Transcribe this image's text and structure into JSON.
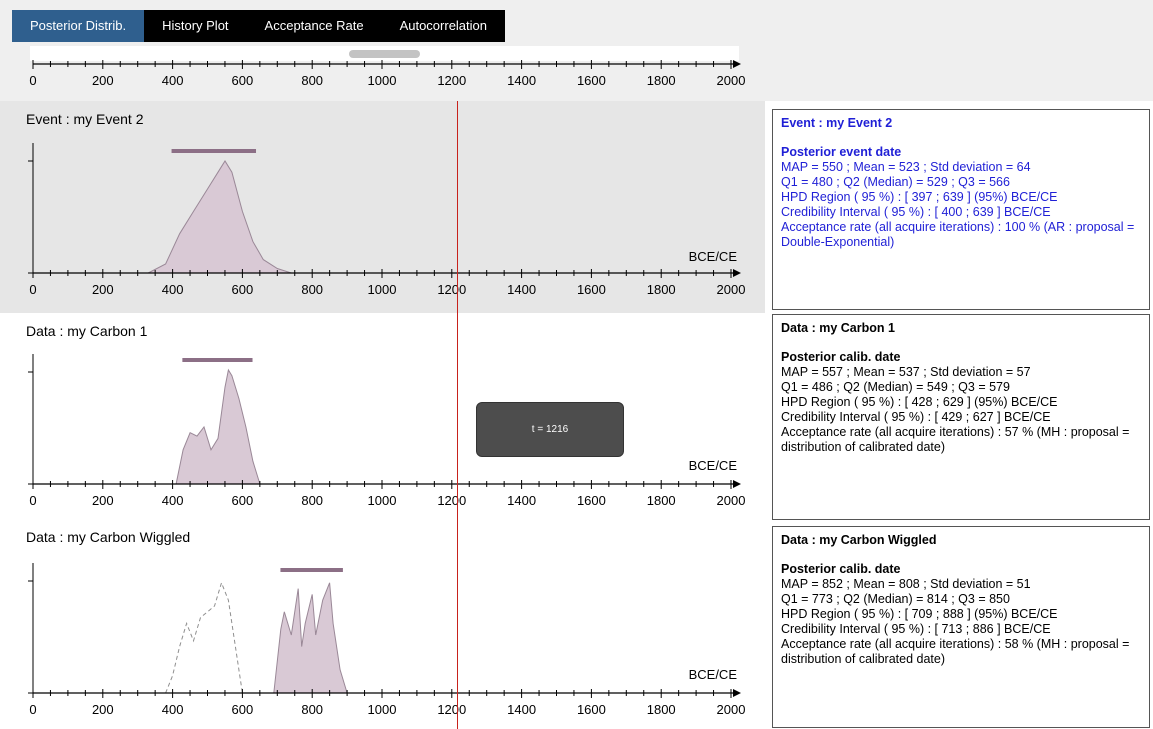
{
  "tabs": [
    {
      "label": "Posterior Distrib.",
      "active": true
    },
    {
      "label": "History Plot",
      "active": false
    },
    {
      "label": "Acceptance Rate",
      "active": false
    },
    {
      "label": "Autocorrelation",
      "active": false
    }
  ],
  "axis": {
    "min": 0,
    "max": 2000,
    "ticks": [
      "0",
      "200",
      "400",
      "600",
      "800",
      "1000",
      "1200",
      "1400",
      "1600",
      "1800",
      "2000"
    ],
    "unit_label": "BCE/CE"
  },
  "scrollbar": {
    "thumb_start": 0.45,
    "thumb_end": 0.55
  },
  "cursor": {
    "value": 1216,
    "tooltip": "t = 1216"
  },
  "panels": [
    {
      "title": "Event : my Event 2",
      "hpd": [
        397,
        639
      ],
      "info": {
        "heading": "Event : my Event 2",
        "subheading": "Posterior event date",
        "lines": [
          "MAP = 550 ; Mean = 523 ; Std deviation = 64",
          "Q1 = 480 ; Q2 (Median) = 529 ; Q3 = 566",
          "HPD Region ( 95 %) : [ 397 ; 639 ] (95%) BCE/CE",
          "Credibility Interval ( 95 %) : [ 400 ; 639 ] BCE/CE",
          "Acceptance rate (all acquire iterations) : 100 % (AR : proposal = Double-Exponential)"
        ]
      }
    },
    {
      "title": "Data : my Carbon 1",
      "hpd": [
        428,
        629
      ],
      "info": {
        "heading": "Data : my Carbon 1",
        "subheading": "Posterior calib. date",
        "lines": [
          "MAP = 557 ; Mean = 537 ; Std deviation = 57",
          "Q1 = 486 ; Q2 (Median) = 549 ; Q3 = 579",
          "HPD Region ( 95 %) : [ 428 ; 629 ] (95%) BCE/CE",
          "Credibility Interval ( 95 %) : [ 429 ; 627 ] BCE/CE",
          "Acceptance rate (all acquire iterations) : 57 % (MH : proposal = distribution of calibrated date)"
        ]
      }
    },
    {
      "title": "Data : my Carbon Wiggled",
      "hpd": [
        709,
        888
      ],
      "info": {
        "heading": "Data : my Carbon Wiggled",
        "subheading": "Posterior calib. date",
        "lines": [
          "MAP = 852 ; Mean = 808 ; Std deviation = 51",
          "Q1 = 773 ; Q2 (Median) = 814 ; Q3 = 850",
          "HPD Region ( 95 %) : [ 709 ; 888 ] (95%) BCE/CE",
          "Credibility Interval ( 95 %) : [ 713 ; 886 ] BCE/CE",
          "Acceptance rate (all acquire iterations) : 58 % (MH : proposal = distribution of calibrated date)"
        ]
      }
    }
  ],
  "colors": {
    "active_tab": "#2f5f8e",
    "hpd_bar": "#8c6f86",
    "density_fill": "#d9c9d5",
    "density_line": "#9a8897",
    "cursor": "#c8221c",
    "event_panel_bg": "#e6e6e6",
    "blue_text": "#1f1fd6"
  },
  "chart_data": [
    {
      "type": "area",
      "title": "Event : my Event 2",
      "xlabel": "BCE/CE",
      "xlim": [
        0,
        2000
      ],
      "series": [
        {
          "x": [
            330,
            380,
            420,
            460,
            500,
            530,
            550,
            570,
            600,
            630,
            660,
            700,
            740
          ],
          "y": [
            0.0,
            0.08,
            0.35,
            0.55,
            0.75,
            0.9,
            1.0,
            0.9,
            0.55,
            0.28,
            0.12,
            0.04,
            0.0
          ]
        }
      ]
    },
    {
      "type": "area",
      "title": "Data : my Carbon 1",
      "xlabel": "BCE/CE",
      "xlim": [
        0,
        2000
      ],
      "series": [
        {
          "x": [
            410,
            430,
            450,
            470,
            490,
            510,
            530,
            550,
            560,
            570,
            590,
            610,
            630,
            650
          ],
          "y": [
            0.0,
            0.3,
            0.45,
            0.42,
            0.5,
            0.3,
            0.4,
            0.85,
            1.0,
            0.95,
            0.75,
            0.5,
            0.2,
            0.0
          ]
        }
      ]
    },
    {
      "type": "area",
      "title": "Data : my Carbon Wiggled",
      "xlabel": "BCE/CE",
      "xlim": [
        0,
        2000
      ],
      "series": [
        {
          "x": [
            690,
            710,
            720,
            740,
            760,
            770,
            780,
            800,
            810,
            830,
            850,
            860,
            880,
            900
          ],
          "y": [
            0.0,
            0.55,
            0.7,
            0.5,
            0.9,
            0.4,
            0.6,
            0.85,
            0.5,
            0.8,
            0.95,
            0.6,
            0.2,
            0.0
          ]
        }
      ],
      "prior_dashed": {
        "x": [
          380,
          400,
          420,
          440,
          460,
          480,
          500,
          520,
          540,
          560,
          580,
          600
        ],
        "y": [
          0.0,
          0.15,
          0.4,
          0.6,
          0.45,
          0.65,
          0.7,
          0.75,
          0.95,
          0.8,
          0.4,
          0.0
        ]
      }
    }
  ]
}
